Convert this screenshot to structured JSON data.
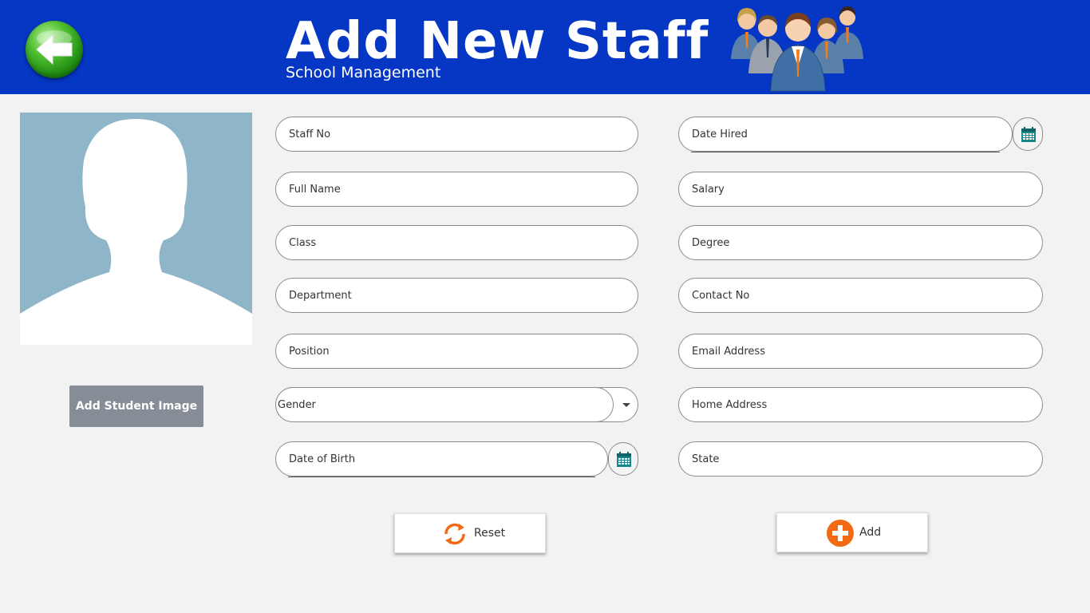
{
  "header": {
    "title": "Add New Staff",
    "subtitle": "School Management"
  },
  "photo": {
    "button_label": "Add Student Image"
  },
  "form": {
    "left": {
      "staff_no": "Staff No",
      "full_name": "Full Name",
      "class": "Class",
      "department": "Department",
      "position": "Position",
      "gender": "Gender",
      "date_of_birth": "Date of Birth"
    },
    "right": {
      "date_hired": "Date Hired",
      "salary": "Salary",
      "degree": "Degree",
      "contact_no": "Contact No",
      "email_address": "Email Address",
      "home_address": "Home Address",
      "state": "State"
    }
  },
  "actions": {
    "reset_label": "Reset",
    "add_label": "Add"
  },
  "icons": {
    "back": "back-arrow-icon",
    "staff_group": "staff-group-icon",
    "calendar": "calendar-icon",
    "dropdown": "chevron-down-icon",
    "reset": "refresh-icon",
    "add": "plus-circle-icon"
  },
  "colors": {
    "header_bg": "#0536c4",
    "accent_orange": "#f26a14",
    "calendar_teal": "#15868a",
    "back_green": "#2e9e1d",
    "image_button_bg": "#868d96"
  }
}
